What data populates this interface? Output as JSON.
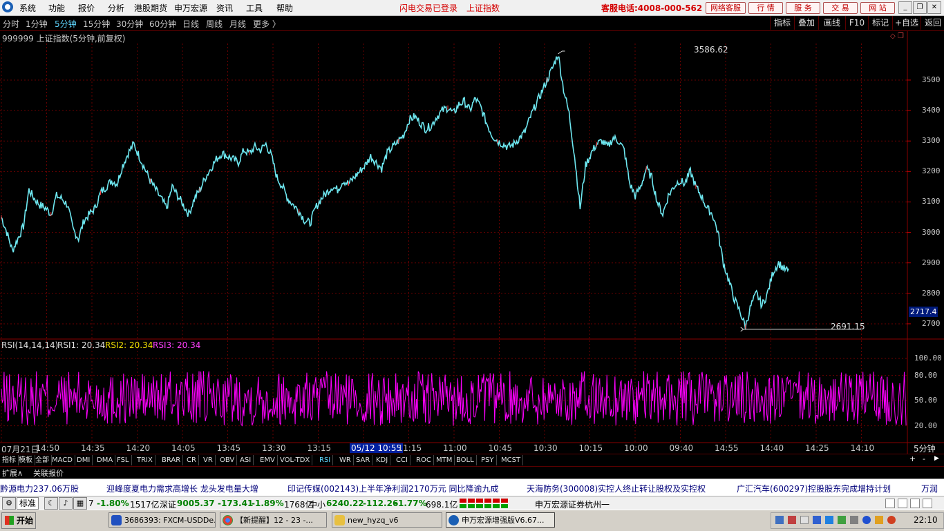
{
  "menubar": {
    "items": [
      "系统",
      "功能",
      "报价",
      "分析",
      "港股期货",
      "申万宏源",
      "资讯",
      "工具",
      "帮助"
    ],
    "status1": "闪电交易已登录",
    "status2": "上证指数",
    "hotline": "客服电话:4008-000-562",
    "buttons": [
      "网络客服",
      "行 情",
      "服 务",
      "交 易",
      "网 站"
    ]
  },
  "periodbar": {
    "periods": [
      "分时",
      "1分钟",
      "5分钟",
      "15分钟",
      "30分钟",
      "60分钟",
      "日线",
      "周线",
      "月线",
      "更多 〉"
    ],
    "active_index": 2,
    "tools": [
      "指标",
      "叠加",
      "画线",
      "F10",
      "标记",
      "+自选",
      "返回"
    ]
  },
  "chart": {
    "title": "999999 上证指数(5分钟,前复权)",
    "high_label": "3586.62",
    "low_label": "2691.15",
    "current_price": "2717.4",
    "price_ticks": [
      "3500",
      "3400",
      "3300",
      "3200",
      "3100",
      "3000",
      "2900",
      "2800",
      "2700"
    ],
    "rsi_title": "RSI(14,14,14)",
    "rsi1": "RSI1: 20.34",
    "rsi2": "RSI2: 20.34",
    "rsi3": "RSI3: 20.34",
    "rsi_ticks": [
      "100.00",
      "80.00",
      "50.00",
      "20.00"
    ],
    "time_ticks": [
      "07月21日",
      "14:50",
      "14:35",
      "14:20",
      "14:05",
      "13:45",
      "13:30",
      "13:15",
      "05/12 10:55",
      "11:15",
      "11:00",
      "10:45",
      "10:30",
      "10:15",
      "10:00",
      "09:40",
      "14:55",
      "14:40",
      "14:25",
      "14:10"
    ],
    "period_label": "5分钟",
    "colors": {
      "price_line": "#6ee7f0",
      "up_tick": "#ff3b3b",
      "rsi": "#ff00ff",
      "grid": "#6a0000"
    }
  },
  "chart_data": {
    "type": "line",
    "ylim": [
      2650,
      3620
    ],
    "series": [
      {
        "name": "上证指数",
        "x_index": [
          0,
          2,
          4,
          6,
          8,
          10,
          12,
          14,
          16,
          18,
          20,
          22,
          24,
          26,
          28,
          30,
          32,
          34,
          36,
          38,
          40,
          42,
          44,
          46,
          48,
          50,
          52,
          54,
          56,
          58,
          60,
          62,
          64,
          66,
          68,
          70,
          72,
          74,
          76,
          78,
          80,
          82,
          84,
          86,
          88,
          90,
          92,
          94,
          96,
          98,
          100,
          102,
          104,
          106,
          108,
          110,
          112,
          114,
          116,
          118,
          120,
          122,
          124,
          126,
          128,
          130,
          132,
          134,
          136,
          138,
          140,
          142,
          144,
          146,
          148,
          150,
          152,
          154,
          156,
          158,
          160,
          162,
          164,
          166,
          168,
          170,
          172,
          174,
          176,
          178,
          180,
          182,
          184,
          186,
          188,
          190,
          192,
          194,
          196,
          198,
          200,
          202,
          204,
          206,
          208,
          210,
          212,
          214,
          216,
          218,
          220,
          222,
          224,
          226,
          228,
          230,
          232,
          234,
          236,
          238,
          240,
          242,
          244,
          246,
          248,
          250,
          252,
          254,
          256,
          258,
          260,
          262,
          264,
          266,
          268,
          270,
          272,
          274,
          276,
          278,
          280,
          282,
          284,
          286,
          288,
          290,
          292,
          294,
          296,
          298,
          300,
          302,
          304,
          306,
          308,
          310,
          312,
          314,
          316,
          318,
          320,
          322,
          324,
          326,
          328
        ],
        "values": [
          3050,
          3000,
          2940,
          2980,
          3020,
          3140,
          3110,
          3090,
          3080,
          3060,
          3120,
          3110,
          3090,
          3010,
          2980,
          3040,
          3060,
          3080,
          3130,
          3150,
          3170,
          3160,
          3220,
          3260,
          3290,
          3250,
          3210,
          3170,
          3140,
          3110,
          3080,
          3150,
          3120,
          3090,
          3060,
          3110,
          3140,
          3180,
          3210,
          3240,
          3260,
          3250,
          3240,
          3230,
          3270,
          3260,
          3280,
          3270,
          3290,
          3250,
          3180,
          3150,
          3110,
          3090,
          3070,
          3040,
          3030,
          3080,
          3110,
          3130,
          3150,
          3140,
          3170,
          3160,
          3180,
          3200,
          3220,
          3250,
          3230,
          3210,
          3260,
          3280,
          3300,
          3320,
          3370,
          3380,
          3360,
          3340,
          3350,
          3380,
          3400,
          3410,
          3390,
          3420,
          3430,
          3400,
          3440,
          3410,
          3360,
          3320,
          3300,
          3290,
          3280,
          3290,
          3310,
          3330,
          3380,
          3420,
          3460,
          3500,
          3540,
          3586,
          3470,
          3390,
          3250,
          3080,
          3220,
          3260,
          3290,
          3300,
          3280,
          3310,
          3300,
          3270,
          3160,
          3120,
          3150,
          3210,
          3180,
          3100,
          3060,
          3120,
          3150,
          3170,
          3160,
          3200,
          3150,
          3120,
          3080,
          3060,
          3000,
          2900,
          2840,
          2780,
          2740,
          2691,
          2760,
          2800,
          2760,
          2800,
          2870,
          2900,
          2880,
          2870
        ]
      }
    ],
    "rsi_ylim": [
      0,
      110
    ],
    "rsi_series": [
      {
        "name": "RSI",
        "range": [
          20,
          85
        ]
      }
    ]
  },
  "indicator_tabs": [
    "指标",
    "模板",
    "全部",
    "MACD",
    "DMI",
    "DMA",
    "FSL",
    "TRIX",
    "BRAR",
    "CR",
    "VR",
    "OBV",
    "ASI",
    "EMV",
    "VOL-TDX",
    "RSI",
    "WR",
    "SAR",
    "KDJ",
    "CCI",
    "ROC",
    "MTM",
    "BOLL",
    "PSY",
    "MCST"
  ],
  "indicator_active": "RSI",
  "expand_row": {
    "expand": "扩展∧",
    "related": "关联报价"
  },
  "zoom_buttons": [
    "+",
    "-",
    "▶"
  ],
  "ticker": [
    "黔源电力237.06万股",
    "迎峰度夏电力需求高增长 龙头发电量大增",
    "印记传媒(002143)上半年净利润2170万元 同比降逾九成",
    "天海防务(300008)实控人终止转让股权及实控权",
    "广汇汽车(600297)控股股东完成增持计划",
    "万润"
  ],
  "statusbar": {
    "mode": "标准",
    "sh_tail": "7",
    "sh_pct": "-1.80%",
    "sh_amt": "1517亿",
    "sz_label": "深证",
    "sz_val": "9005.37",
    "sz_chg": "-173.41",
    "sz_pct": "-1.89%",
    "sz_amt": "1768亿",
    "zx_label": "中小",
    "zx_val": "6240.22",
    "zx_chg": "-112.26",
    "zx_pct": "-1.77%",
    "zx_amt": "698.1亿",
    "broker": "申万宏源证券杭州一"
  },
  "taskbar": {
    "start": "开始",
    "tasks": [
      "3686393: FXCM-USDDe...",
      "【新提醒】12 - 23 -...",
      "new_hyzq_v6",
      "申万宏源增强版V6.67..."
    ],
    "clock": "22:10"
  }
}
